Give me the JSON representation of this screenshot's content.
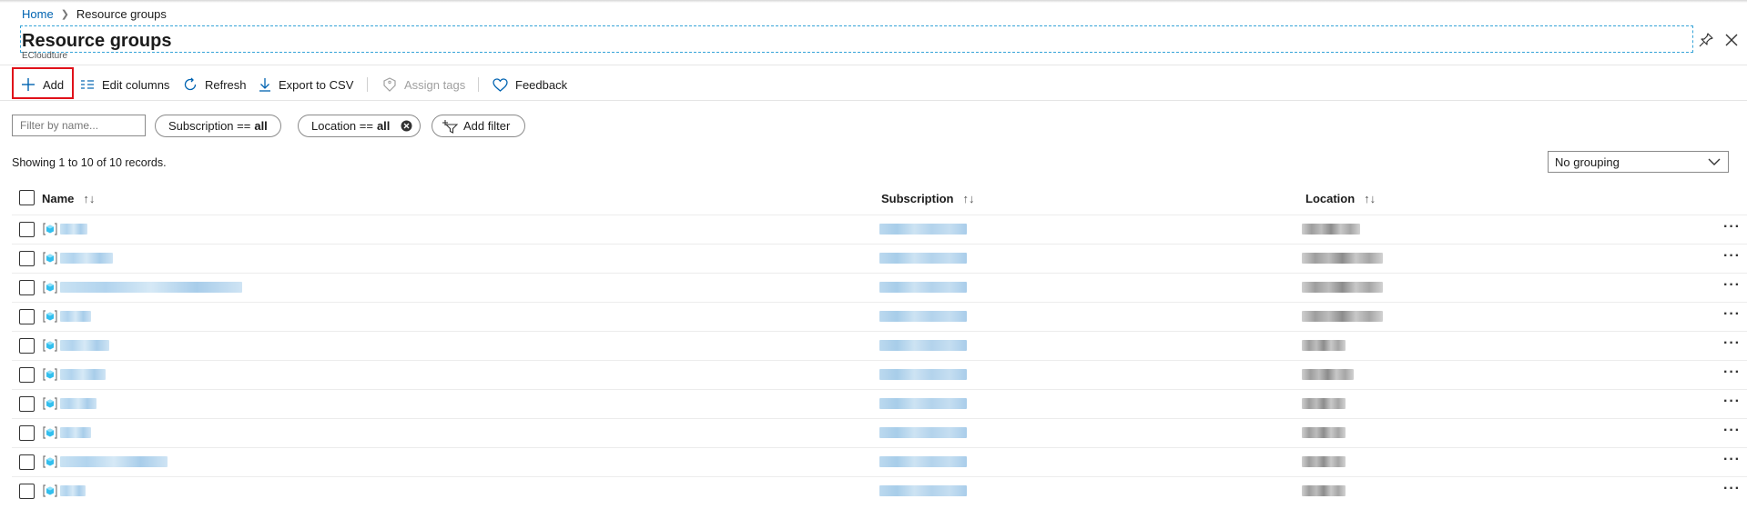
{
  "breadcrumb": {
    "home": "Home",
    "current": "Resource groups"
  },
  "page": {
    "title": "Resource groups",
    "subtitle": "ECloudture"
  },
  "toolbar": {
    "add": "Add",
    "edit_columns": "Edit columns",
    "refresh": "Refresh",
    "export_csv": "Export to CSV",
    "assign_tags": "Assign tags",
    "feedback": "Feedback"
  },
  "filters": {
    "name_placeholder": "Filter by name...",
    "subscription_label": "Subscription ==",
    "subscription_value": "all",
    "location_label": "Location ==",
    "location_value": "all",
    "add_filter": "Add filter"
  },
  "records_text": "Showing 1 to 10 of 10 records.",
  "grouping": {
    "selected": "No grouping"
  },
  "table": {
    "columns": {
      "name": "Name",
      "subscription": "Subscription",
      "location": "Location"
    },
    "sort_glyph": "↑↓",
    "more_glyph": "···",
    "row_count": 10
  },
  "colors": {
    "accent": "#0063b1",
    "highlight": "#e0111a"
  },
  "icons": [
    "pin-icon",
    "close-icon",
    "plus-icon",
    "edit-columns-icon",
    "refresh-icon",
    "download-icon",
    "tag-icon",
    "heart-icon",
    "filter-icon",
    "chevron-down-icon",
    "resource-group-icon",
    "more-icon"
  ]
}
